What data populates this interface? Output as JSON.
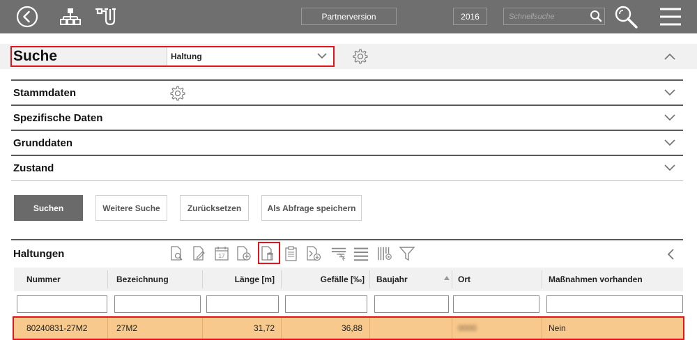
{
  "topbar": {
    "partner_label": "Partnerversion",
    "year": "2016",
    "quicksearch_placeholder": "Schnellsuche",
    "icons": [
      "back-icon",
      "network-icon",
      "pipe-icon",
      "search-icon",
      "zoom-search-icon",
      "menu-icon"
    ]
  },
  "search": {
    "title": "Suche",
    "type_value": "Haltung",
    "settings_icon": "gear-icon",
    "collapse_icon": "chevron-up-icon"
  },
  "sections": [
    {
      "label": "Stammdaten",
      "has_settings": true
    },
    {
      "label": "Spezifische Daten",
      "has_settings": false
    },
    {
      "label": "Grunddaten",
      "has_settings": false
    },
    {
      "label": "Zustand",
      "has_settings": false
    }
  ],
  "buttons": {
    "search": "Suchen",
    "more_search": "Weitere Suche",
    "reset": "Zurücksetzen",
    "save_query": "Als Abfrage speichern"
  },
  "results": {
    "title": "Haltungen",
    "toolbar_icons": [
      "document-search-icon",
      "document-edit-icon",
      "calendar-icon",
      "document-add-icon",
      "document-delete-icon",
      "clipboard-icon",
      "document-export-icon",
      "column-select-icon",
      "rows-icon",
      "columns-settings-icon",
      "filter-icon"
    ],
    "collapse_icon": "chevron-left-icon",
    "columns": [
      "Nummer",
      "Bezeichnung",
      "Länge [m]",
      "Gefälle [‰]",
      "Baujahr",
      "Ort",
      "Maßnahmen vorhanden"
    ],
    "sorted_column": "Baujahr",
    "rows": [
      {
        "nummer": "80240831-27M2",
        "bezeichnung": "27M2",
        "laenge": "31,72",
        "gefaelle": "36,88",
        "baujahr": "",
        "ort": "0000",
        "massnahmen": "Nein"
      }
    ]
  },
  "colors": {
    "topbar": "#6f6f6f",
    "highlight": "#e2141b",
    "selected_row": "#f7c98c",
    "primary_button": "#6a6a6a"
  }
}
